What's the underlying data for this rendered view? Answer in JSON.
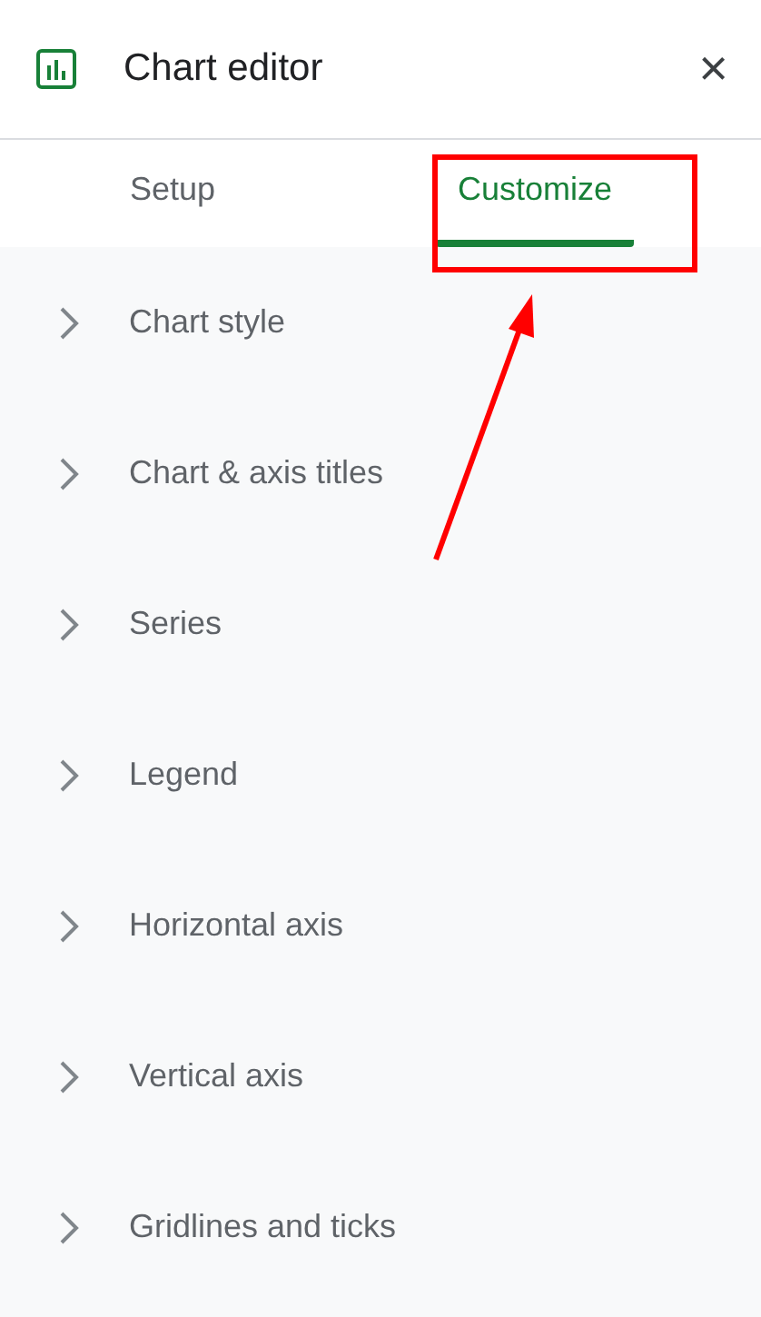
{
  "window": {
    "title": "Chart editor",
    "close": "×"
  },
  "tabs": [
    {
      "label": "Setup",
      "selected": false
    },
    {
      "label": "Customize",
      "selected": true
    }
  ],
  "sections": [
    {
      "label": "Chart style",
      "expanded": false
    },
    {
      "label": "Chart & axis titles",
      "expanded": false
    },
    {
      "label": "Series",
      "expanded": false
    },
    {
      "label": "Legend",
      "expanded": false
    },
    {
      "label": "Horizontal axis",
      "expanded": false
    },
    {
      "label": "Vertical axis",
      "expanded": false
    },
    {
      "label": "Gridlines and ticks",
      "expanded": false
    }
  ]
}
